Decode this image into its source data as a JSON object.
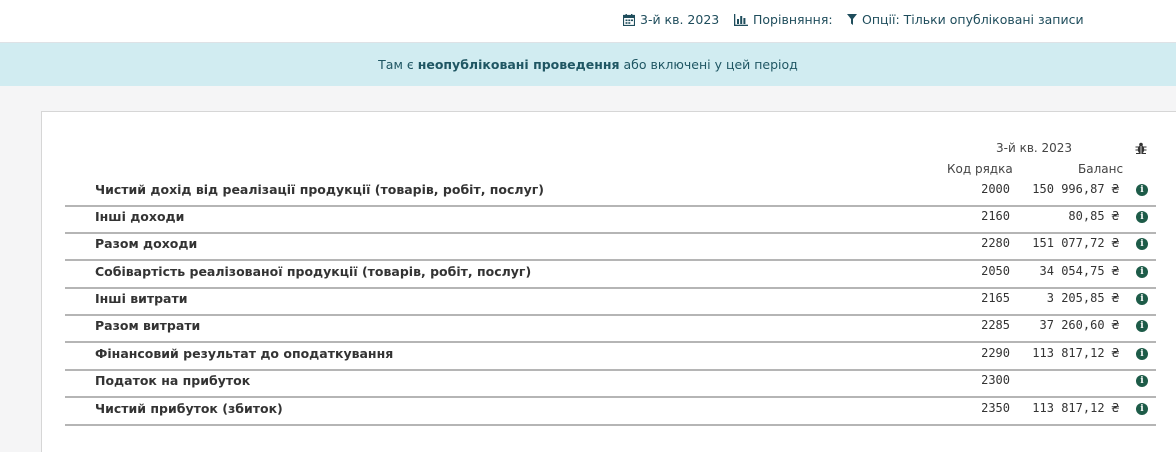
{
  "toolbar": {
    "period_label": "3-й кв. 2023",
    "compare_label": "Порівняння:",
    "options_label": "Опції: Тільки опубліковані записи"
  },
  "alert": {
    "prefix": "Там є",
    "bold": "неопубліковані проведення",
    "suffix": "або включені у цей період"
  },
  "report": {
    "period": "3-й кв. 2023",
    "col_code": "Код рядка",
    "col_balance": "Баланс",
    "rows": [
      {
        "label": "Чистий дохід від реалізації продукції (товарів, робіт, послуг)",
        "code": "2000",
        "value": "150 996,87 ₴"
      },
      {
        "label": "Інші доходи",
        "code": "2160",
        "value": "80,85 ₴"
      },
      {
        "label": "Разом доходи",
        "code": "2280",
        "value": "151 077,72 ₴"
      },
      {
        "label": "Собівартість реалізованої продукції (товарів, робіт, послуг)",
        "code": "2050",
        "value": "34 054,75 ₴"
      },
      {
        "label": "Інші витрати",
        "code": "2165",
        "value": "3 205,85 ₴"
      },
      {
        "label": "Разом витрати",
        "code": "2285",
        "value": "37 260,60 ₴"
      },
      {
        "label": "Фінансовий результат до оподаткування",
        "code": "2290",
        "value": "113 817,12 ₴"
      },
      {
        "label": "Податок на прибуток",
        "code": "2300",
        "value": ""
      },
      {
        "label": "Чистий прибуток (збиток)",
        "code": "2350",
        "value": "113 817,12 ₴"
      }
    ]
  },
  "icons": {
    "calendar": "calendar-icon",
    "chart": "bar-chart-icon",
    "filter": "filter-icon",
    "bug": "bug-icon",
    "info": "info-icon"
  },
  "colors": {
    "accent": "#1f4d5c",
    "alert_bg": "#d1ecf1",
    "info_icon": "#1d5b48"
  }
}
